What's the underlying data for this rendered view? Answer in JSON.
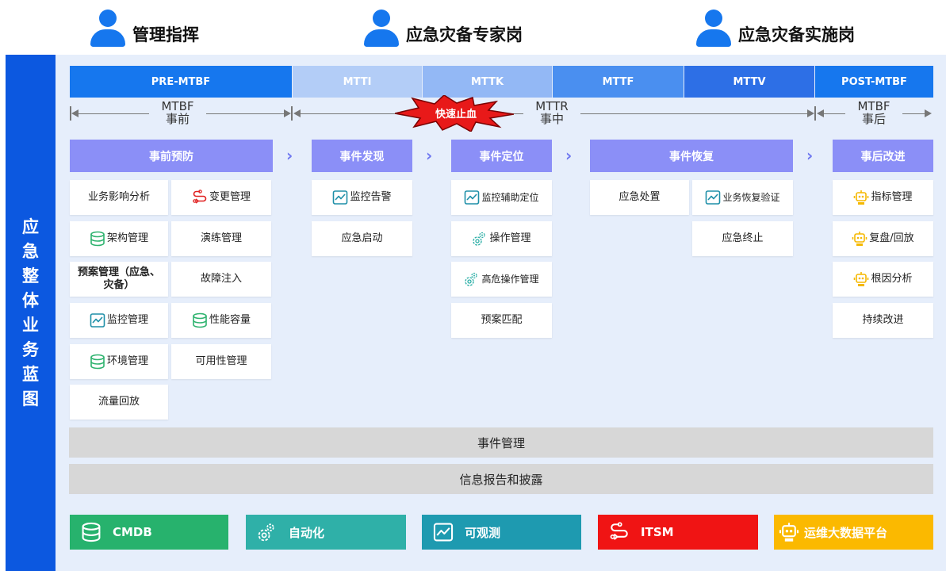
{
  "roles": [
    {
      "label": "管理指挥"
    },
    {
      "label": "应急灾备专家岗"
    },
    {
      "label": "应急灾备实施岗"
    }
  ],
  "side_title": "应急整体业务蓝图",
  "phases": [
    {
      "label": "PRE-MTBF",
      "color": "#1677ee"
    },
    {
      "label": "MTTI",
      "color": "#b3cdf7"
    },
    {
      "label": "MTTK",
      "color": "#93b8f5"
    },
    {
      "label": "MTTF",
      "color": "#4a8ff0"
    },
    {
      "label": "MTTV",
      "color": "#2d6fe6"
    },
    {
      "label": "POST-MTBF",
      "color": "#1677ee"
    }
  ],
  "timeline": {
    "pre_top": "MTBF",
    "pre_bottom": "事前",
    "mid_top": "MTTR",
    "mid_bottom": "事中",
    "post_top": "MTBF",
    "post_bottom": "事后",
    "burst": "快速止血"
  },
  "stages": [
    {
      "label": "事前预防"
    },
    {
      "label": "事件发现"
    },
    {
      "label": "事件定位"
    },
    {
      "label": "事件恢复"
    },
    {
      "label": "事后改进"
    }
  ],
  "cards": {
    "c1": "业务影响分析",
    "c2": "变更管理",
    "c3": "架构管理",
    "c4": "演练管理",
    "c5": "预案管理（应急、灾备）",
    "c6": "故障注入",
    "c7": "监控管理",
    "c8": "性能容量",
    "c9": "环境管理",
    "c10": "可用性管理",
    "c11": "流量回放",
    "c12": "监控告警",
    "c13": "应急启动",
    "c14": "监控辅助定位",
    "c15": "操作管理",
    "c16": "高危操作管理",
    "c17": "预案匹配",
    "c18": "应急处置",
    "c19": "业务恢复验证",
    "c20": "应急终止",
    "c21": "指标管理",
    "c22": "复盘/回放",
    "c23": "根因分析",
    "c24": "持续改进"
  },
  "bars": {
    "event_mgmt": "事件管理",
    "info_report": "信息报告和披露"
  },
  "platforms": [
    {
      "label": "CMDB",
      "color": "#27b26d",
      "icon": "database-icon"
    },
    {
      "label": "自动化",
      "color": "#2fb0a8",
      "icon": "gear-icon"
    },
    {
      "label": "可观测",
      "color": "#1e9ab0",
      "icon": "chart-line-icon"
    },
    {
      "label": "ITSM",
      "color": "#f01414",
      "icon": "flow-icon"
    },
    {
      "label": "运维大数据平台",
      "color": "#fbb900",
      "icon": "robot-icon"
    }
  ],
  "colors": {
    "side_bar": "#0c58e0",
    "panel": "#e6eefb",
    "stage": "#8b8ff7",
    "icon_green": "#2fb36f",
    "icon_teal": "#1e8fa8",
    "icon_red": "#e02020",
    "icon_yellow": "#f5b800"
  }
}
